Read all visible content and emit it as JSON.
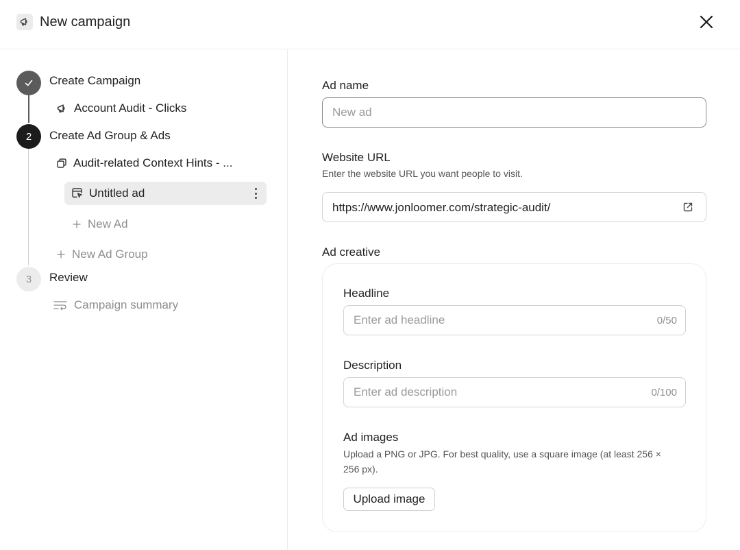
{
  "header": {
    "title": "New campaign"
  },
  "steps": [
    {
      "number": "",
      "label": "Create Campaign",
      "state": "done"
    },
    {
      "number": "2",
      "label": "Create Ad Group & Ads",
      "state": "active"
    },
    {
      "number": "3",
      "label": "Review",
      "state": "pending"
    }
  ],
  "tree": {
    "campaign": "Account Audit - Clicks",
    "ad_group": "Audit-related Context Hints - ...",
    "selected_ad": "Untitled ad",
    "new_ad": "New Ad",
    "new_ad_group": "New Ad Group",
    "summary": "Campaign summary"
  },
  "form": {
    "ad_name": {
      "label": "Ad name",
      "placeholder": "New ad",
      "value": ""
    },
    "website_url": {
      "label": "Website URL",
      "help": "Enter the website URL you want people to visit.",
      "value": "https://www.jonloomer.com/strategic-audit/"
    },
    "creative": {
      "label": "Ad creative",
      "headline": {
        "label": "Headline",
        "placeholder": "Enter ad headline",
        "counter": "0/50"
      },
      "description": {
        "label": "Description",
        "placeholder": "Enter ad description",
        "counter": "0/100"
      },
      "images": {
        "label": "Ad images",
        "help_line1": "Upload a PNG or JPG. For best quality, use a square image (at least 256 ×",
        "help_line2": "256 px).",
        "button": "Upload image"
      }
    }
  },
  "colors": {
    "step_done": "#5b5b5b",
    "step_active": "#1c1c1c",
    "step_pending": "#ececec",
    "selected_bg": "#ececec"
  },
  "icons": {
    "header": "megaphone-icon",
    "close": "close-icon",
    "campaign": "megaphone-icon",
    "ad_group": "stack-icon",
    "ad": "ad-cursor-icon",
    "summary": "list-wrap-icon",
    "external": "external-link-icon"
  }
}
